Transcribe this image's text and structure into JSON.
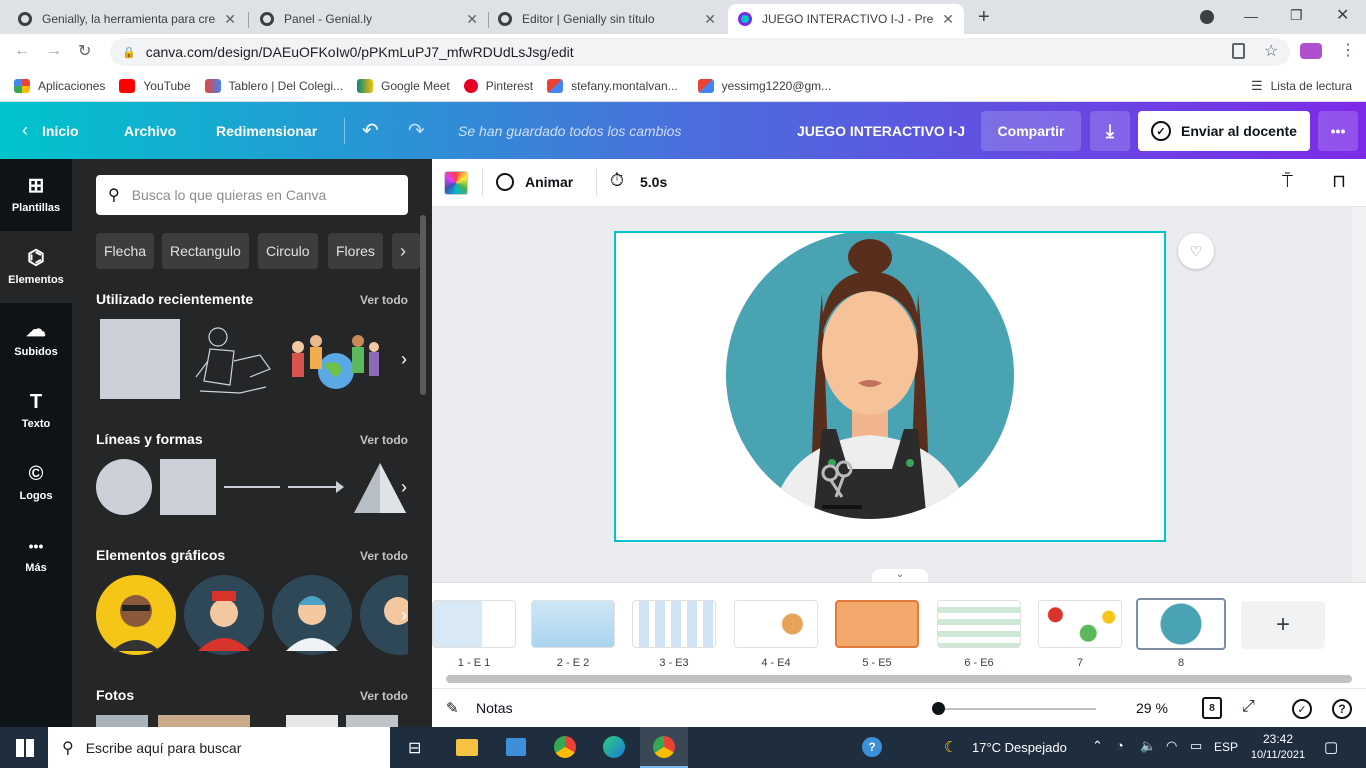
{
  "browser": {
    "tabs": [
      {
        "title": "Genially, la herramienta para crea",
        "close": "✕"
      },
      {
        "title": "Panel - Genial.ly",
        "close": "✕"
      },
      {
        "title": "Editor | Genially sin título",
        "close": "✕"
      },
      {
        "title": "JUEGO INTERACTIVO I-J - Presen",
        "close": "✕"
      }
    ],
    "new_tab": "+",
    "url": "canva.com/design/DAEuOFKoIw0/pPKmLuPJ7_mfwRDUdLsJsg/edit",
    "bookmarks": [
      {
        "label": "Aplicaciones",
        "color": "#e8453c"
      },
      {
        "label": "YouTube",
        "color": "#ff0000"
      },
      {
        "label": "Tablero | Del Colegi...",
        "color": "#4285f4"
      },
      {
        "label": "Google Meet",
        "color": "#00897b"
      },
      {
        "label": "Pinterest",
        "color": "#e60023"
      },
      {
        "label": "stefany.montalvan...",
        "color": "#ea4335"
      },
      {
        "label": "yessimg1220@gm...",
        "color": "#ea4335"
      }
    ],
    "reading_list": "Lista de lectura"
  },
  "header": {
    "home": "Inicio",
    "file": "Archivo",
    "resize": "Redimensionar",
    "saved_status": "Se han guardado todos los cambios",
    "design_title": "JUEGO INTERACTIVO  I-J",
    "share": "Compartir",
    "send": "Enviar al docente",
    "more": "•••"
  },
  "rail": [
    {
      "label": "Plantillas",
      "icon": "⊞"
    },
    {
      "label": "Elementos",
      "icon": "⌬"
    },
    {
      "label": "Subidos",
      "icon": "☁"
    },
    {
      "label": "Texto",
      "icon": "T"
    },
    {
      "label": "Logos",
      "icon": "©"
    },
    {
      "label": "Más",
      "icon": "•••"
    }
  ],
  "panel": {
    "search_placeholder": "Busca lo que quieras en Canva",
    "chips": [
      "Flecha",
      "Rectangulo",
      "Circulo",
      "Flores"
    ],
    "sections": [
      {
        "title": "Utilizado recientemente",
        "see_all": "Ver todo"
      },
      {
        "title": "Líneas y formas",
        "see_all": "Ver todo"
      },
      {
        "title": "Elementos gráficos",
        "see_all": "Ver todo"
      },
      {
        "title": "Fotos",
        "see_all": "Ver todo"
      }
    ]
  },
  "editor_toolbar": {
    "animate": "Animar",
    "duration": "5.0s"
  },
  "pages": [
    {
      "label": "1 - E 1"
    },
    {
      "label": "2 - E 2"
    },
    {
      "label": "3 - E3"
    },
    {
      "label": "4 - E4"
    },
    {
      "label": "5 - E5"
    },
    {
      "label": "6 - E6"
    },
    {
      "label": "7"
    },
    {
      "label": "8"
    }
  ],
  "bottom": {
    "notes": "Notas",
    "zoom_percent": 29,
    "zoom_label": "29 %",
    "page_count": "8"
  },
  "taskbar": {
    "search_placeholder": "Escribe aquí para buscar",
    "weather": "17°C  Despejado",
    "lang": "ESP",
    "time": "23:42",
    "date": "10/11/2021"
  }
}
